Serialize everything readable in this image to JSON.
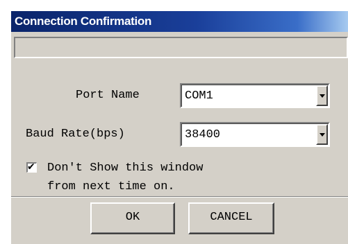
{
  "window": {
    "title": "Connection Confirmation",
    "status_text": ""
  },
  "form": {
    "port_name_label": "Port Name",
    "port_name_value": "COM1",
    "baud_rate_label": "Baud Rate(bps)",
    "baud_rate_value": "38400"
  },
  "checkbox": {
    "checked": true,
    "label_line1": "Don't Show this window",
    "label_line2": "from next time on."
  },
  "buttons": {
    "ok_label": "OK",
    "cancel_label": "CANCEL"
  },
  "colors": {
    "title_bar": "#0a246a",
    "window_face": "#d4d0c8"
  },
  "icons": {
    "dropdown": "chevron-down-icon",
    "check": "checkmark-icon"
  }
}
